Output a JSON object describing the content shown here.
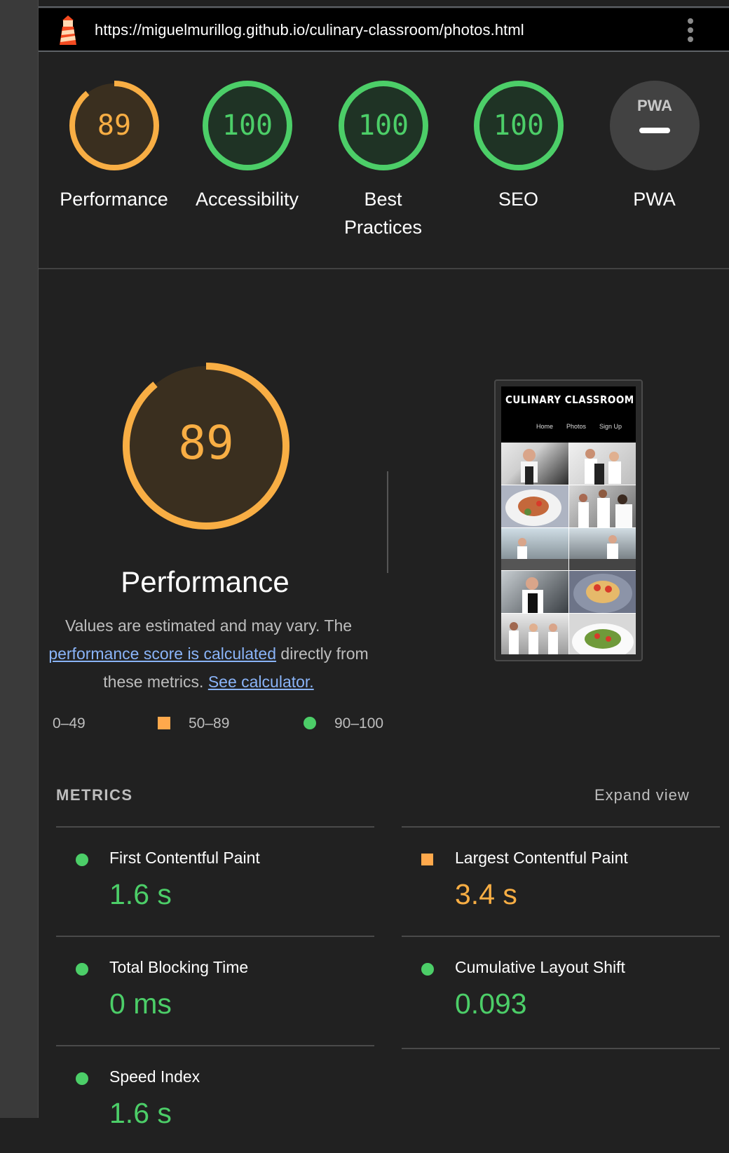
{
  "url": "https://miguelmurillog.github.io/culinary-classroom/photos.html",
  "colors": {
    "pass": "#4cce68",
    "average": "#f8ae44",
    "fail": "#ff4e42",
    "link": "#8ab4f8"
  },
  "gauges": [
    {
      "score": "89",
      "label": "Performance",
      "status": "average",
      "fraction": 0.89
    },
    {
      "score": "100",
      "label": "Accessibility",
      "status": "pass",
      "fraction": 1.0
    },
    {
      "score": "100",
      "label": "Best\nPractices",
      "label_line1": "Best",
      "label_line2": "Practices",
      "status": "pass",
      "fraction": 1.0
    },
    {
      "score": "100",
      "label": "SEO",
      "status": "pass",
      "fraction": 1.0
    },
    {
      "score": "PWA",
      "label": "PWA",
      "status": "na"
    }
  ],
  "performance": {
    "score": "89",
    "fraction": 0.89,
    "title": "Performance",
    "desc_prefix": "Values are estimated and may vary. The",
    "desc_link": "performance score is calculated",
    "desc_mid": "directly from these metrics.",
    "calc_link": "See calculator."
  },
  "screenshot": {
    "site_title": "CULINARY CLASSROOM",
    "nav": [
      "Home",
      "Photos",
      "Sign Up"
    ]
  },
  "legend": [
    {
      "range": "0–49",
      "shape": "triangle"
    },
    {
      "range": "50–89",
      "shape": "square"
    },
    {
      "range": "90–100",
      "shape": "circle"
    }
  ],
  "metrics_heading": "METRICS",
  "expand_label": "Expand view",
  "metrics": [
    {
      "name": "First Contentful Paint",
      "value": "1.6 s",
      "status": "pass"
    },
    {
      "name": "Largest Contentful Paint",
      "value": "3.4 s",
      "status": "average"
    },
    {
      "name": "Total Blocking Time",
      "value": "0 ms",
      "status": "pass"
    },
    {
      "name": "Cumulative Layout Shift",
      "value": "0.093",
      "status": "pass"
    },
    {
      "name": "Speed Index",
      "value": "1.6 s",
      "status": "pass"
    }
  ]
}
